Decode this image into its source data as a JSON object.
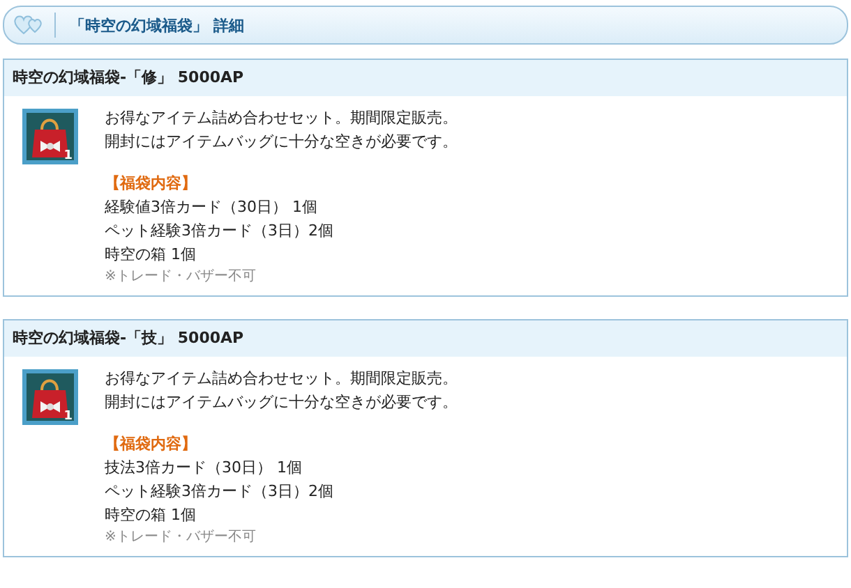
{
  "header": {
    "title": "「時空の幻域福袋」 詳細"
  },
  "items": [
    {
      "title": "時空の幻域福袋-「修」 5000AP",
      "quantity": "1",
      "description": [
        "お得なアイテム詰め合わせセット。期間限定販売。",
        "開封にはアイテムバッグに十分な空きが必要です。"
      ],
      "contents_heading": "【福袋内容】",
      "contents": [
        "経験値3倍カード（30日） 1個",
        "ペット経験3倍カード（3日）2個",
        "時空の箱 1個"
      ],
      "note": "※トレード・バザー不可"
    },
    {
      "title": "時空の幻域福袋-「技」 5000AP",
      "quantity": "1",
      "description": [
        "お得なアイテム詰め合わせセット。期間限定販売。",
        "開封にはアイテムバッグに十分な空きが必要です。"
      ],
      "contents_heading": "【福袋内容】",
      "contents": [
        "技法3倍カード（30日） 1個",
        "ペット経験3倍カード（3日）2個",
        "時空の箱 1個"
      ],
      "note": "※トレード・バザー不可"
    }
  ]
}
